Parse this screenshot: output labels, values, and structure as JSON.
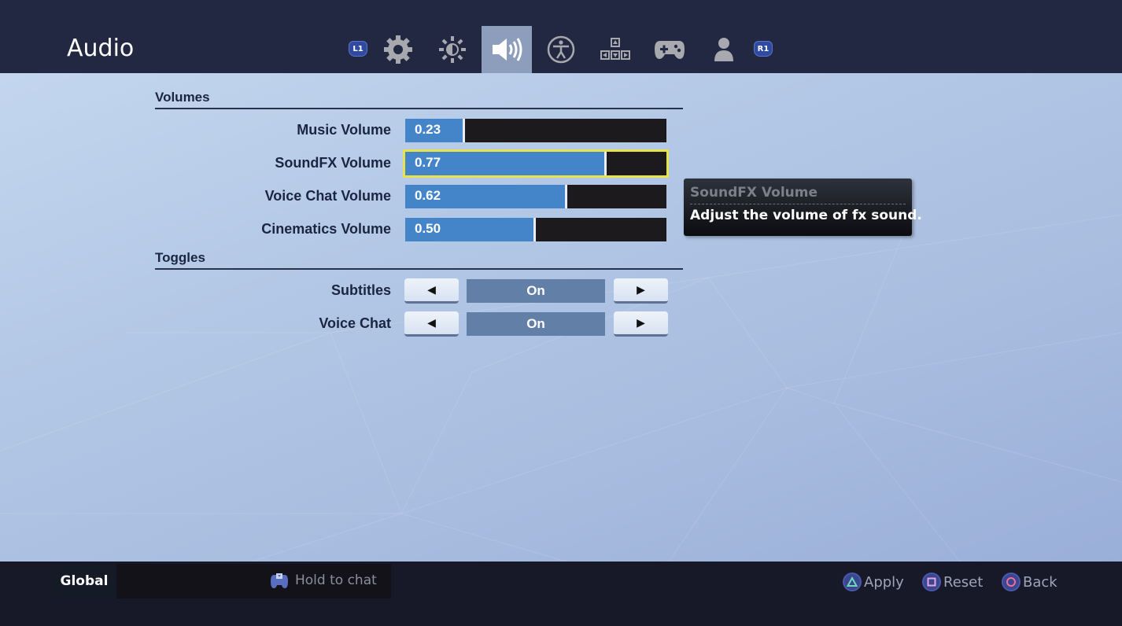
{
  "header": {
    "title": "Audio",
    "shoulder_left": "L1",
    "shoulder_right": "R1",
    "tabs": [
      {
        "icon": "gear-icon",
        "label": "Game",
        "active": false
      },
      {
        "icon": "brightness-icon",
        "label": "Video",
        "active": false
      },
      {
        "icon": "speaker-icon",
        "label": "Audio",
        "active": true
      },
      {
        "icon": "accessibility-icon",
        "label": "Accessibility",
        "active": false
      },
      {
        "icon": "dpad-icon",
        "label": "Input",
        "active": false
      },
      {
        "icon": "gamepad-icon",
        "label": "Controller",
        "active": false
      },
      {
        "icon": "person-icon",
        "label": "Account",
        "active": false
      }
    ]
  },
  "sections": {
    "volumes": {
      "title": "Volumes",
      "items": [
        {
          "label": "Music Volume",
          "value": "0.23",
          "fraction": 0.23,
          "focused": false
        },
        {
          "label": "SoundFX Volume",
          "value": "0.77",
          "fraction": 0.77,
          "focused": true
        },
        {
          "label": "Voice Chat Volume",
          "value": "0.62",
          "fraction": 0.62,
          "focused": false
        },
        {
          "label": "Cinematics Volume",
          "value": "0.50",
          "fraction": 0.5,
          "focused": false
        }
      ]
    },
    "toggles": {
      "title": "Toggles",
      "items": [
        {
          "label": "Subtitles",
          "value": "On",
          "prev_glyph": "◀",
          "next_glyph": "▶"
        },
        {
          "label": "Voice Chat",
          "value": "On",
          "prev_glyph": "◀",
          "next_glyph": "▶"
        }
      ]
    }
  },
  "tooltip": {
    "title": "SoundFX Volume",
    "body": "Adjust the volume of fx sound."
  },
  "footer": {
    "chat_channel": "Global",
    "chat_hint": "Hold to chat",
    "actions": [
      {
        "label": "Apply",
        "button": "triangle",
        "color": "#6fd8b8"
      },
      {
        "label": "Reset",
        "button": "square",
        "color": "#e3a6e0"
      },
      {
        "label": "Back",
        "button": "circle",
        "color": "#ef6c9c"
      }
    ]
  },
  "colors": {
    "accent_fill": "#4484c8",
    "focus_outline": "#e8e34a",
    "toggle_value_bg": "#627fa8",
    "active_tab_bg": "#8d9ebd"
  }
}
